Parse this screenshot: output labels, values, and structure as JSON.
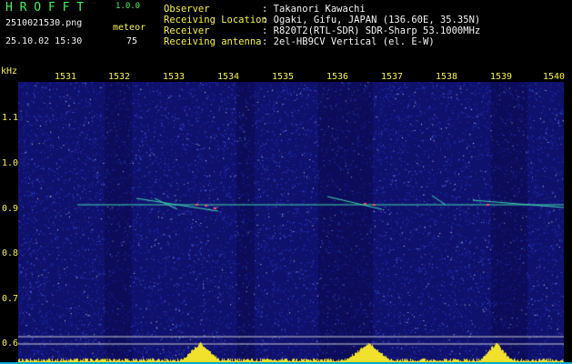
{
  "header": {
    "logo": "H R O F F T",
    "version": "1.0.0",
    "filename": "2510021530.png",
    "detector": "meteor",
    "datetime": "25.10.02 15:30",
    "meteor_count": "75"
  },
  "info": [
    {
      "label": "Observer",
      "value": ": Takanori Kawachi"
    },
    {
      "label": "Receiving Location",
      "value": ": Ogaki, Gifu, JAPAN (136.60E, 35.35N)"
    },
    {
      "label": "Receiver",
      "value": ": R820T2(RTL-SDR) SDR-Sharp 53.1000MHz"
    },
    {
      "label": "Receiving antenna",
      "value": ": 2el-HB9CV Vertical (el. E-W)"
    }
  ],
  "axes": {
    "y_unit": "kHz",
    "x_ticks": [
      "1531",
      "1532",
      "1533",
      "1534",
      "1535",
      "1536",
      "1537",
      "1538",
      "1539",
      "1540"
    ],
    "y_ticks": [
      "1.1",
      "1.0",
      "0.9",
      "0.8",
      "0.7",
      "0.6"
    ]
  },
  "colors": {
    "background": "#10116c",
    "signal": "#3fd6b0",
    "hot": "#ff4f6a",
    "activity": "#f2e12c",
    "baseline": "#0aa8c8"
  }
}
